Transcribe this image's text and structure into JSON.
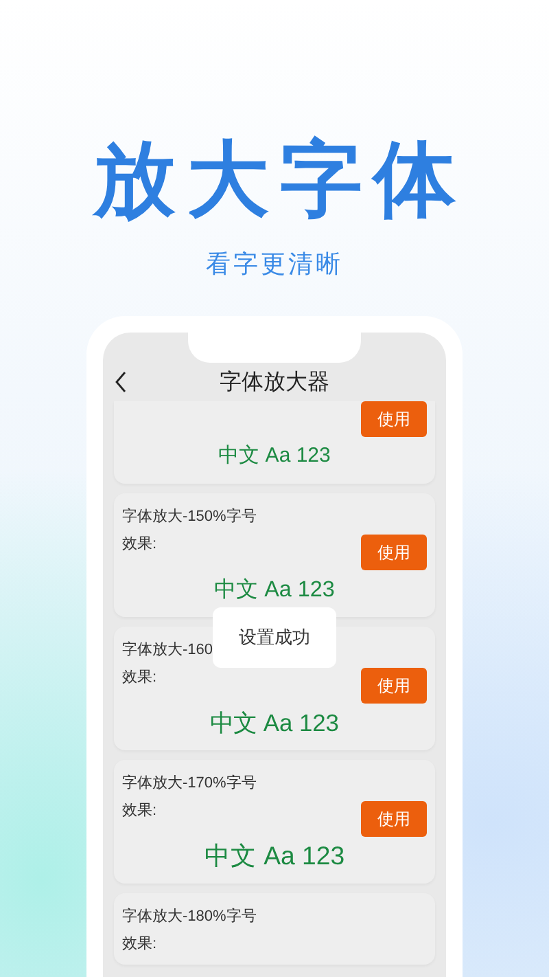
{
  "hero": {
    "title": "放大字体",
    "subtitle": "看字更清晰"
  },
  "header": {
    "title": "字体放大器"
  },
  "cards": [
    {
      "kind": "cut-top",
      "preview": "中文 Aa 123",
      "button": "使用"
    },
    {
      "kind": "full",
      "label": "字体放大-150%字号",
      "effect": "效果:",
      "preview": "中文 Aa 123",
      "button": "使用"
    },
    {
      "kind": "full",
      "label": "字体放大-160",
      "effect": "效果:",
      "preview": "中文 Aa 123",
      "button": "使用"
    },
    {
      "kind": "full",
      "label": "字体放大-170%字号",
      "effect": "效果:",
      "preview": "中文 Aa 123",
      "button": "使用"
    },
    {
      "kind": "cut-bottom",
      "label": "字体放大-180%字号",
      "effect": "效果:"
    }
  ],
  "toast": "设置成功"
}
